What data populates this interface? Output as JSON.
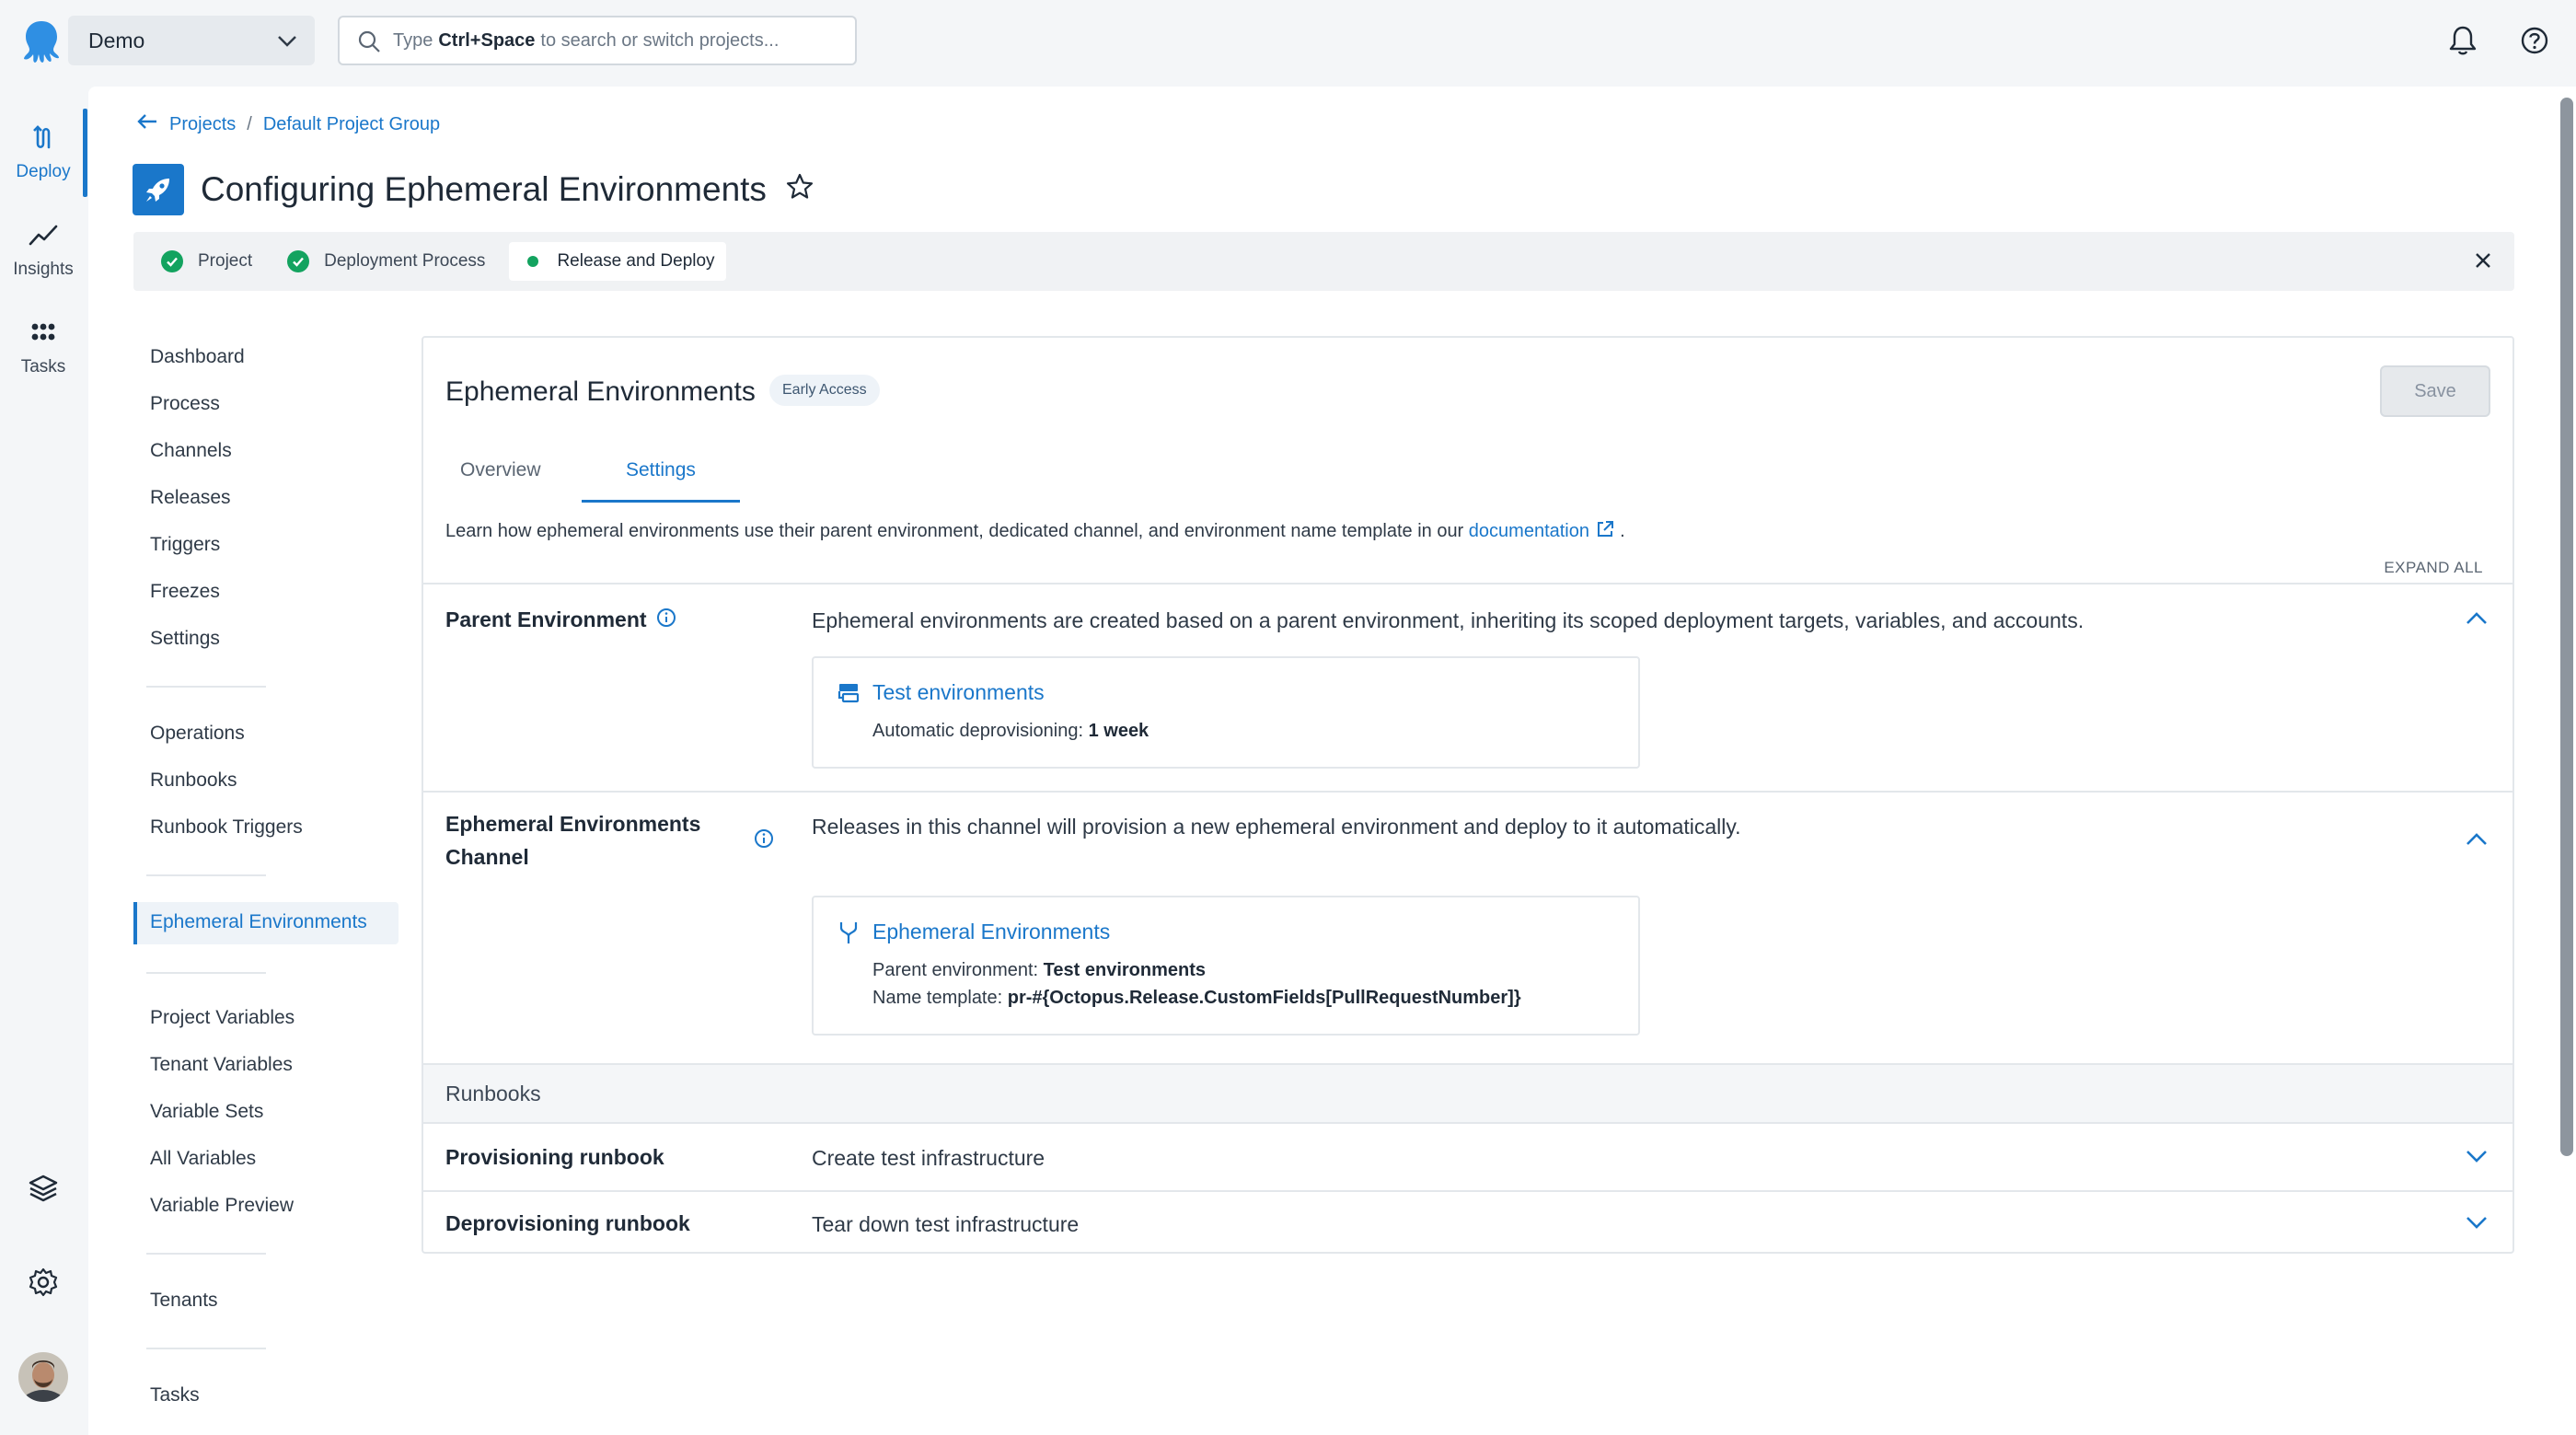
{
  "topbar": {
    "space_name": "Demo",
    "search_prefix": "Type",
    "search_shortcut": "Ctrl+Space",
    "search_suffix": "to search or switch projects..."
  },
  "rail": {
    "deploy": "Deploy",
    "insights": "Insights",
    "tasks": "Tasks"
  },
  "breadcrumb": {
    "projects": "Projects",
    "separator": "/",
    "group": "Default Project Group"
  },
  "page": {
    "title": "Configuring Ephemeral Environments"
  },
  "stepper": {
    "steps": [
      {
        "label": "Project",
        "state": "done"
      },
      {
        "label": "Deployment Process",
        "state": "done"
      },
      {
        "label": "Release and Deploy",
        "state": "current"
      }
    ]
  },
  "sidenav": {
    "groups": [
      [
        "Dashboard",
        "Process",
        "Channels",
        "Releases",
        "Triggers",
        "Freezes",
        "Settings"
      ],
      [
        "Operations",
        "Runbooks",
        "Runbook Triggers"
      ],
      [
        "Ephemeral Environments"
      ],
      [
        "Project Variables",
        "Tenant Variables",
        "Variable Sets",
        "All Variables",
        "Variable Preview"
      ],
      [
        "Tenants"
      ],
      [
        "Tasks"
      ]
    ],
    "active": "Ephemeral Environments"
  },
  "panel": {
    "title": "Ephemeral Environments",
    "badge": "Early Access",
    "save_label": "Save",
    "tabs": [
      "Overview",
      "Settings"
    ],
    "active_tab": "Settings",
    "learn_text": "Learn how ephemeral environments use their parent environment, dedicated channel, and environment name template in our",
    "learn_link": "documentation",
    "learn_end": ".",
    "expand_all": "EXPAND ALL"
  },
  "parent_env": {
    "label": "Parent Environment",
    "description": "Ephemeral environments are created based on a parent environment, inheriting its scoped deployment targets, variables, and accounts.",
    "card_title": "Test environments",
    "deprovision_label": "Automatic deprovisioning:",
    "deprovision_value": "1 week"
  },
  "channel": {
    "label_line1": "Ephemeral Environments",
    "label_line2": "Channel",
    "description": "Releases in this channel will provision a new ephemeral environment and deploy to it automatically.",
    "card_title": "Ephemeral Environments",
    "parent_label": "Parent environment:",
    "parent_value": "Test environments",
    "template_label": "Name template:",
    "template_value": "pr-#{Octopus.Release.CustomFields[PullRequestNumber]}"
  },
  "runbooks": {
    "header": "Runbooks",
    "provisioning_label": "Provisioning runbook",
    "provisioning_value": "Create test infrastructure",
    "deprovisioning_label": "Deprovisioning runbook",
    "deprovisioning_value": "Tear down test infrastructure"
  },
  "colors": {
    "accent": "#1a77ca",
    "success": "#13a35f"
  }
}
